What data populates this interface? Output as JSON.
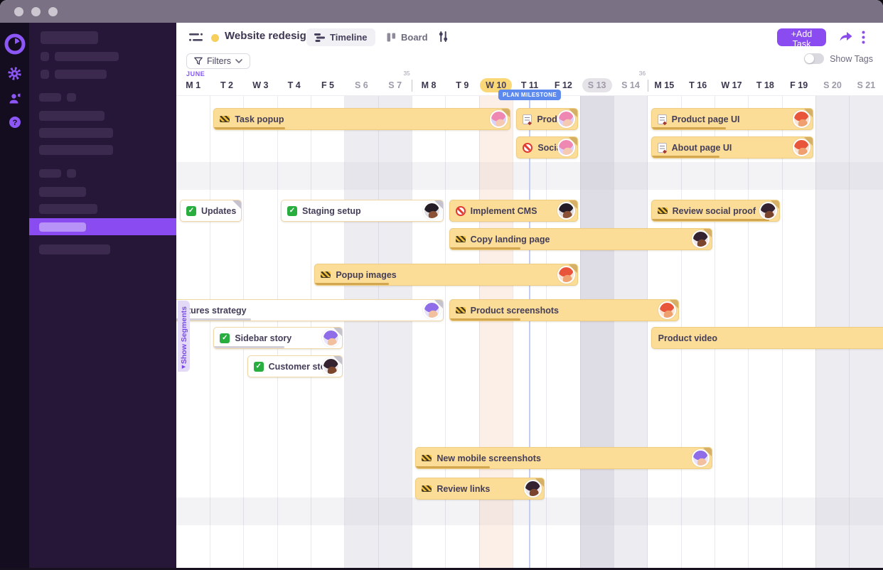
{
  "theme": {
    "accent_purple": "#8a4cf0",
    "sidebar_bg": "#261738",
    "titlebar_bg": "#7b7184",
    "bar_yellow": "#fbdd98",
    "today_pill_yellow": "#fbd877",
    "milestone_blue": "#5c89ee",
    "project_dot_yellow": "#f6cf5c"
  },
  "header": {
    "project_title": "Website redesign",
    "tabs": [
      {
        "label": "Timeline",
        "active": true
      },
      {
        "label": "Board",
        "active": false
      }
    ],
    "add_task_label": "+Add Task",
    "filters_label": "Filters",
    "show_tags_label": "Show Tags",
    "show_tags_on": false
  },
  "timeline": {
    "month_label": "JUNE",
    "days": [
      {
        "label": "M 1"
      },
      {
        "label": "T 2"
      },
      {
        "label": "W 3"
      },
      {
        "label": "T 4"
      },
      {
        "label": "F 5"
      },
      {
        "label": "S 6",
        "weekend": true
      },
      {
        "label": "S 7",
        "weekend": true
      },
      {
        "label": "M 8"
      },
      {
        "label": "T 9"
      },
      {
        "label": "W 10",
        "today": true
      },
      {
        "label": "T 11"
      },
      {
        "label": "F 12"
      },
      {
        "label": "S 13",
        "weekend": true,
        "selected": true
      },
      {
        "label": "S 14",
        "weekend": true
      },
      {
        "label": "M 15"
      },
      {
        "label": "T 16"
      },
      {
        "label": "W 17"
      },
      {
        "label": "T 18"
      },
      {
        "label": "F 19"
      },
      {
        "label": "S 20",
        "weekend": true
      },
      {
        "label": "S 21",
        "weekend": true
      }
    ],
    "week_markers": [
      {
        "label": "35",
        "before_index": 7
      },
      {
        "label": "36",
        "before_index": 14
      }
    ],
    "milestone": {
      "label": "PLAN MILESTONE",
      "center_day_index": 10.5
    },
    "show_segments_label": "Show Segments"
  },
  "tasks": [
    {
      "label": "Task popup",
      "icon": "barrier",
      "row": 0,
      "start": 2,
      "end": 10,
      "style": "yellow",
      "avatar": "pink",
      "progress": 24
    },
    {
      "label": "Produc",
      "icon": "notepad",
      "row": 0,
      "start": 11,
      "end": 12,
      "style": "yellow",
      "avatar": "pink",
      "progress": null
    },
    {
      "label": "Product page UI",
      "icon": "notepad",
      "row": 0,
      "start": 15,
      "end": 19,
      "style": "yellow",
      "avatar": "orange",
      "progress": 46
    },
    {
      "label": "Social",
      "icon": "no-entry",
      "row": 1,
      "start": 11,
      "end": 12,
      "style": "yellow",
      "avatar": "pink",
      "progress": null
    },
    {
      "label": "About page UI",
      "icon": "notepad",
      "row": 1,
      "start": 15,
      "end": 19,
      "style": "yellow",
      "avatar": "orange",
      "progress": 42
    },
    {
      "label": "Updates",
      "icon": "check",
      "row": 2,
      "start": 1,
      "end": 2,
      "style": "white",
      "avatar": null,
      "progress": null
    },
    {
      "label": "Staging setup",
      "icon": "check",
      "row": 2,
      "start": 4,
      "end": 8,
      "style": "white",
      "avatar": "darkman",
      "progress": null
    },
    {
      "label": "Implement CMS",
      "icon": "no-entry",
      "row": 2,
      "start": 9,
      "end": 12,
      "style": "yellow",
      "avatar": "darkman",
      "progress": null
    },
    {
      "label": "Review social proof",
      "icon": "barrier",
      "row": 2,
      "start": 15,
      "end": 18,
      "style": "yellow",
      "avatar": "darkwoman",
      "progress": 92
    },
    {
      "label": "Copy landing page",
      "icon": "barrier",
      "row": 3,
      "start": 9,
      "end": 16,
      "style": "yellow",
      "avatar": "darkwoman",
      "progress": 27
    },
    {
      "label": "Popup images",
      "icon": "barrier",
      "row": 4,
      "start": 5,
      "end": 12,
      "style": "yellow",
      "avatar": "orange",
      "progress": 28
    },
    {
      "label": "atures strategy",
      "icon": null,
      "row": 5,
      "start": 1,
      "end": 8,
      "style": "white",
      "avatar": "purple",
      "progress": 28,
      "clip": "left"
    },
    {
      "label": "Product screenshots",
      "icon": "barrier",
      "row": 5,
      "start": 9,
      "end": 15,
      "style": "yellow",
      "avatar": "orange",
      "progress": 31
    },
    {
      "label": "Sidebar story",
      "icon": "check",
      "row": 6,
      "start": 2,
      "end": 5,
      "style": "white",
      "avatar": "purple",
      "progress": 55
    },
    {
      "label": "Product video",
      "icon": null,
      "row": 6,
      "start": 15,
      "end": 22,
      "style": "yellow",
      "avatar": null,
      "progress": null,
      "clip": "right",
      "fold": false
    },
    {
      "label": "Customer storie",
      "icon": "check",
      "row": 7,
      "start": 3,
      "end": 5,
      "style": "white",
      "avatar": "darkwoman",
      "progress": null
    },
    {
      "label": "New mobile screenshots",
      "icon": "barrier",
      "row": 8,
      "start": 8,
      "end": 16,
      "style": "yellow",
      "avatar": "purple",
      "progress": 25
    },
    {
      "label": "Review links",
      "icon": "barrier",
      "row": 9,
      "start": 8,
      "end": 11,
      "style": "yellow",
      "avatar": "darkwoman",
      "progress": null
    }
  ]
}
